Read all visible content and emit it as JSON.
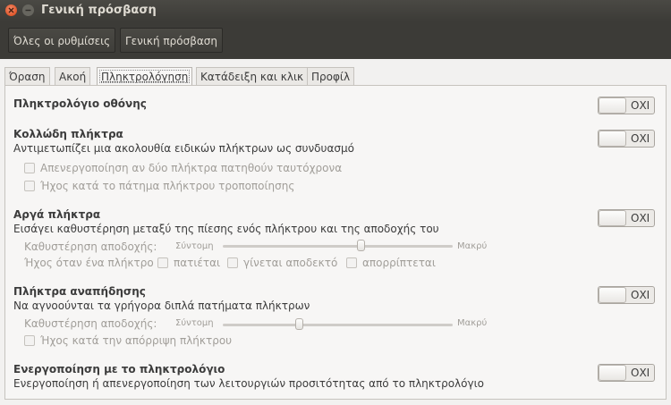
{
  "window": {
    "title": "Γενική πρόσβαση"
  },
  "toolbar": {
    "all_settings": "Όλες οι ρυθμίσεις",
    "current": "Γενική πρόσβαση"
  },
  "tabs": [
    {
      "label": "Όραση"
    },
    {
      "label": "Ακοή"
    },
    {
      "label": "Πληκτρολόγηση"
    },
    {
      "label": "Κατάδειξη και κλικ"
    },
    {
      "label": "Προφίλ"
    }
  ],
  "switch_off_label": "ΟΧΙ",
  "sections": {
    "onscreen": {
      "title": "Πληκτρολόγιο οθόνης"
    },
    "sticky": {
      "title": "Κολλώδη πλήκτρα",
      "desc": "Αντιμετωπίζει μια ακολουθία ειδικών πλήκτρων ως συνδυασμό",
      "opt1": "Απενεργοποίηση αν δύο πλήκτρα πατηθούν ταυτόχρονα",
      "opt2": "Ήχος κατά το πάτημα πλήκτρου τροποποίησης"
    },
    "slow": {
      "title": "Αργά πλήκτρα",
      "desc": "Εισάγει καθυστέρηση μεταξύ της πίεσης ενός πλήκτρου και της αποδοχής του",
      "delay_label": "Καθυστέρηση αποδοχής:",
      "short": "Σύντομη",
      "long": "Μακρύ",
      "delay_value": 0.6,
      "beep_label": "Ήχος όταν ένα πλήκτρο",
      "beep_pressed": "πατιέται",
      "beep_accepted": "γίνεται αποδεκτό",
      "beep_rejected": "απορρίπτεται"
    },
    "bounce": {
      "title": "Πλήκτρα αναπήδησης",
      "desc": "Να αγνοούνται τα γρήγορα διπλά πατήματα πλήκτρων",
      "delay_label": "Καθυστέρηση αποδοχής:",
      "short": "Σύντομη",
      "long": "Μακρύ",
      "delay_value": 0.33,
      "opt1": "Ήχος κατά την απόρριψη πλήκτρου"
    },
    "keyboard_enable": {
      "title": "Ενεργοποίηση με το πληκτρολόγιο",
      "desc": "Ενεργοποίηση ή απενεργοποίηση των λειτουργιών προσιτότητας από το πληκτρολόγιο"
    }
  }
}
